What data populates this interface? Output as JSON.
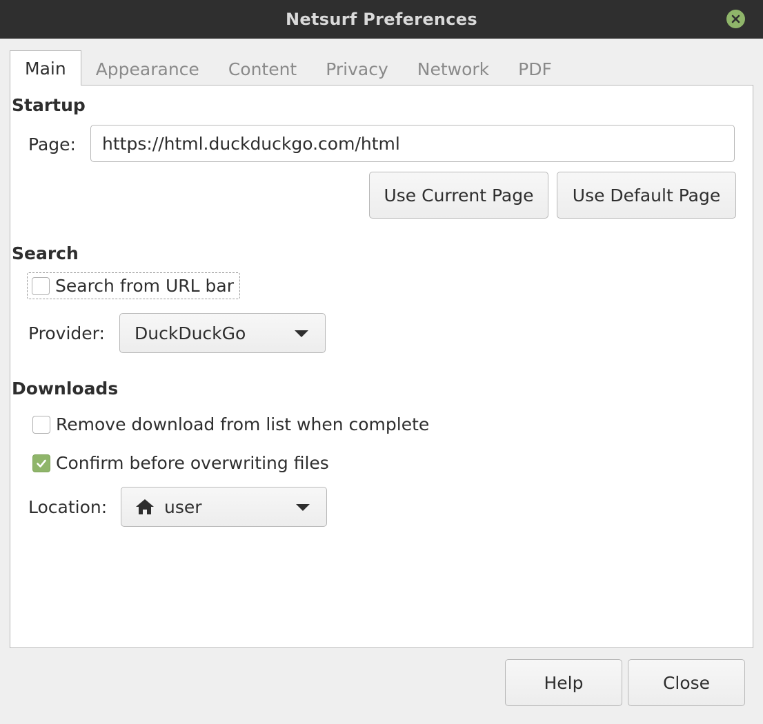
{
  "window": {
    "title": "Netsurf Preferences"
  },
  "tabs": [
    {
      "label": "Main",
      "active": true
    },
    {
      "label": "Appearance",
      "active": false
    },
    {
      "label": "Content",
      "active": false
    },
    {
      "label": "Privacy",
      "active": false
    },
    {
      "label": "Network",
      "active": false
    },
    {
      "label": "PDF",
      "active": false
    }
  ],
  "startup": {
    "heading": "Startup",
    "page_label": "Page:",
    "page_value": "https://html.duckduckgo.com/html",
    "use_current_label": "Use Current Page",
    "use_default_label": "Use Default Page"
  },
  "search": {
    "heading": "Search",
    "from_url_bar_label": "Search from URL bar",
    "from_url_bar_checked": false,
    "provider_label": "Provider:",
    "provider_value": "DuckDuckGo"
  },
  "downloads": {
    "heading": "Downloads",
    "remove_label": "Remove download from list when complete",
    "remove_checked": false,
    "confirm_label": "Confirm before overwriting files",
    "confirm_checked": true,
    "location_label": "Location:",
    "location_value": "user",
    "location_icon": "home-icon"
  },
  "footer": {
    "help_label": "Help",
    "close_label": "Close"
  },
  "colors": {
    "titlebar": "#2f2f2f",
    "accent": "#8fb56a",
    "background": "#efefef"
  }
}
